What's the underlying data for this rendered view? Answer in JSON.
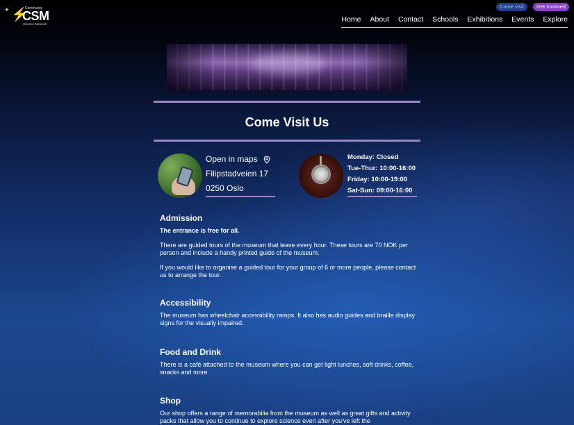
{
  "logo": {
    "community": "Community",
    "name": "CSM",
    "subtitle": "Science Museum"
  },
  "header": {
    "come_visit": "Come visit",
    "get_involved": "Get Involved"
  },
  "nav": {
    "items": [
      "Home",
      "About",
      "Contact",
      "Schools",
      "Exhibitions",
      "Events",
      "Explore"
    ]
  },
  "page": {
    "title": "Come Visit Us"
  },
  "location": {
    "maps_link": "Open in maps",
    "street": "Filipstadveien 17",
    "postcode_city": "0250 Oslo",
    "icon": "map-pin-icon"
  },
  "hours": {
    "lines": [
      "Monday: Closed",
      "Tue-Thur: 10:00-16:00",
      "Friday: 10:00-19:00",
      "Sat-Sun: 09:00-16:00"
    ]
  },
  "sections": {
    "admission": {
      "heading": "Admission",
      "p1": "The entrance is free for all.",
      "p2": "There are guided tours of the museum that leave every hour. These tours are 70 NOK per person and include a handy printed guide of the museum.",
      "p3": "If you would like to organise a guided tour for your group of 6 or more people, please contact us to arrange the tour."
    },
    "accessibility": {
      "heading": "Accessibility",
      "p1": "The museum has wheelchair accessibility ramps. It also has audio guides and braille display signs for the visually impaired."
    },
    "food": {
      "heading": "Food and Drink",
      "p1": "There is a café attached to the museum where you can get light lunches, soft drinks, coffee, snacks and more."
    },
    "shop": {
      "heading": "Shop",
      "p1": "Our shop offers a range of memorabilia from the museum as well as great gifts and activity packs that allow you to continue to explore science even after you've left the"
    }
  },
  "colors": {
    "accent": "#9a88c6",
    "pill_visit": "#1e3f8a",
    "pill_involved": "#8a3cc6"
  }
}
